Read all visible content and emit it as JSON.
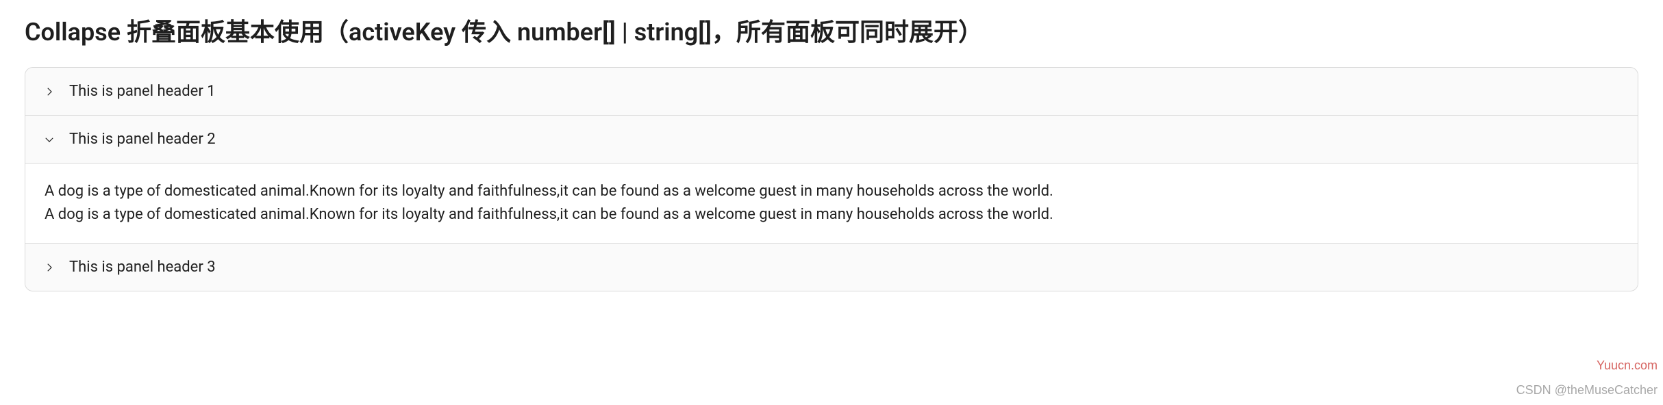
{
  "title": "Collapse 折叠面板基本使用（activeKey 传入 number[] | string[]，所有面板可同时展开）",
  "panels": [
    {
      "header": "This is panel header 1",
      "expanded": false,
      "content": []
    },
    {
      "header": "This is panel header 2",
      "expanded": true,
      "content": [
        "A dog is a type of domesticated animal.Known for its loyalty and faithfulness,it can be found as a welcome guest in many households across the world.",
        "A dog is a type of domesticated animal.Known for its loyalty and faithfulness,it can be found as a welcome guest in many households across the world."
      ]
    },
    {
      "header": "This is panel header 3",
      "expanded": false,
      "content": []
    }
  ],
  "watermarks": {
    "site": "Yuucn.com",
    "author": "CSDN @theMuseCatcher"
  }
}
